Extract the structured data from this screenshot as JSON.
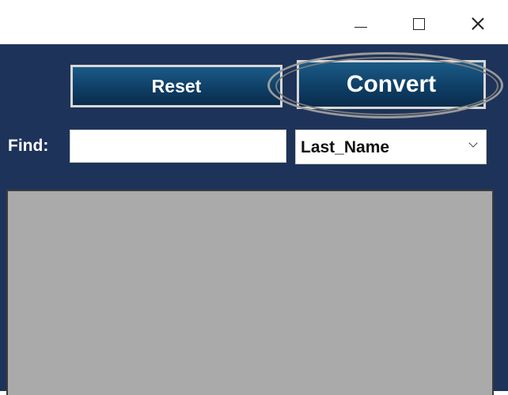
{
  "window": {
    "minimize_icon": "minimize-icon",
    "maximize_icon": "maximize-icon",
    "close_icon": "close-icon"
  },
  "toolbar": {
    "reset_label": "Reset",
    "convert_label": "Convert"
  },
  "search": {
    "find_label": "Find:",
    "value": "",
    "field_selected": "Last_Name"
  },
  "colors": {
    "app_background": "#1e3359",
    "button_gradient_top": "#1a5b87",
    "button_gradient_bottom": "#0a2c4c",
    "list_background": "#aaaaaa",
    "highlight_ellipse": "#9a9a9a"
  }
}
